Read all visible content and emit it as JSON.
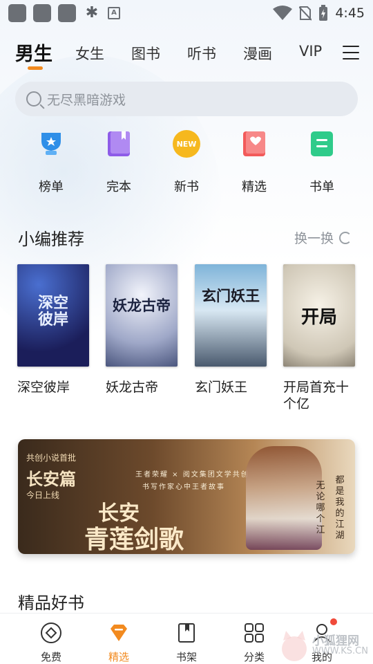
{
  "status_bar": {
    "bug_icon": "bug-icon",
    "a_label": "A",
    "time": "4:45"
  },
  "nav": {
    "tabs": [
      {
        "label": "男生",
        "active": true
      },
      {
        "label": "女生"
      },
      {
        "label": "图书"
      },
      {
        "label": "听书"
      },
      {
        "label": "漫画"
      },
      {
        "label": "VIP"
      }
    ],
    "accent": "#f28a1f"
  },
  "search": {
    "placeholder": "无尽黑暗游戏"
  },
  "quick_links": [
    {
      "label": "榜单",
      "icon": "trophy-icon",
      "color": "#2f8fe8"
    },
    {
      "label": "完本",
      "icon": "book-icon",
      "color": "#8e5ce8"
    },
    {
      "label": "新书",
      "icon": "new-badge-icon",
      "color": "#f6b81e",
      "badge": "NEW"
    },
    {
      "label": "精选",
      "icon": "heart-book-icon",
      "color": "#f25a5a"
    },
    {
      "label": "书单",
      "icon": "list-icon",
      "color": "#2fcb8a"
    }
  ],
  "editor_picks": {
    "title": "小编推荐",
    "refresh_label": "换一换",
    "books": [
      {
        "title": "深空彼岸",
        "cover_text": "深空彼岸"
      },
      {
        "title": "妖龙古帝",
        "cover_text": "妖龙古帝"
      },
      {
        "title": "玄门妖王",
        "cover_text": "玄门妖王"
      },
      {
        "title": "开局首充十个亿",
        "cover_text": "开局"
      }
    ]
  },
  "banner": {
    "eyebrow": "共创小说首批",
    "subtitle": "长安篇",
    "day": "今日上线",
    "collab_line1": "王者荣耀 × 阅文集团文学共创",
    "collab_line2": "书写作家心中王者故事",
    "main_line1": "长安",
    "main_line2": "青莲剑歌",
    "side1": "无论哪个江",
    "side2": "都是我的江湖"
  },
  "quality": {
    "title": "精品好书"
  },
  "tab_bar": {
    "items": [
      {
        "label": "免费",
        "icon": "diamond-icon"
      },
      {
        "label": "精选",
        "icon": "gem-icon",
        "active": true
      },
      {
        "label": "书架",
        "icon": "bookshelf-icon"
      },
      {
        "label": "分类",
        "icon": "grid-icon"
      },
      {
        "label": "我的",
        "icon": "user-icon",
        "has_dot": true
      }
    ]
  },
  "watermark": {
    "text": "小狐狸网",
    "url": "WWW.KS.CN"
  }
}
